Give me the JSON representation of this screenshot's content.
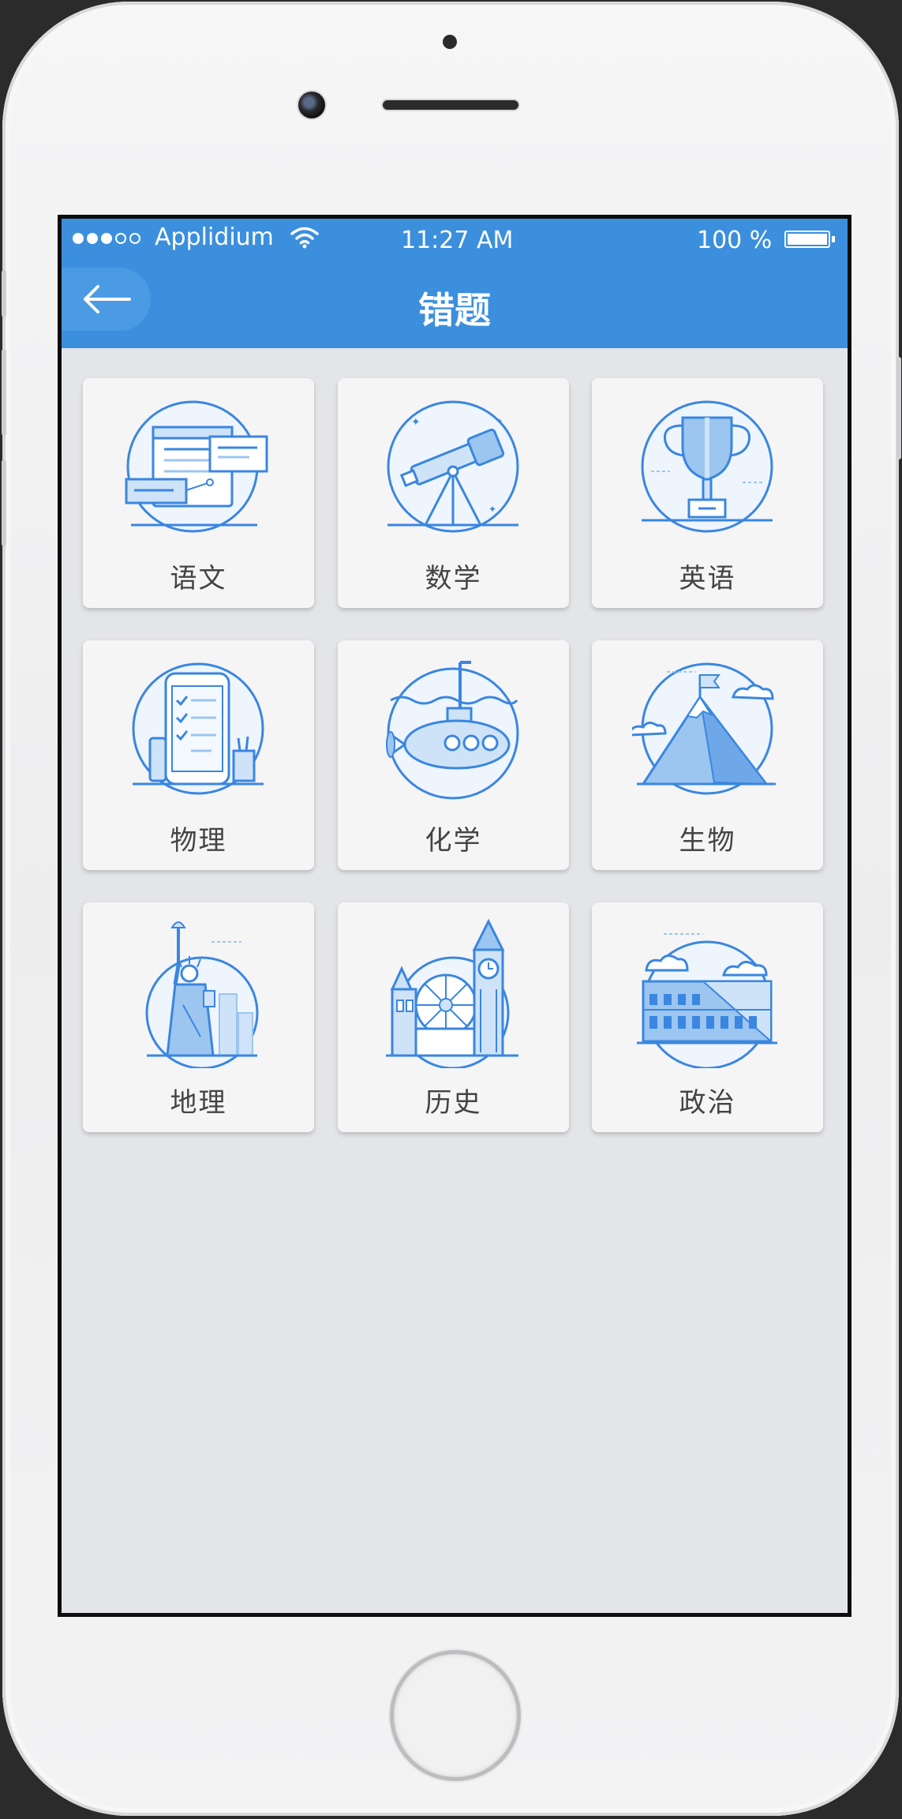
{
  "status_bar": {
    "carrier": "Applidium",
    "time": "11:27 AM",
    "battery": "100 %"
  },
  "nav": {
    "title": "错题",
    "back_icon": "arrow-left-icon"
  },
  "subjects": [
    {
      "label": "语文",
      "icon": "documents-icon"
    },
    {
      "label": "数学",
      "icon": "telescope-icon"
    },
    {
      "label": "英语",
      "icon": "trophy-icon"
    },
    {
      "label": "物理",
      "icon": "phone-checklist-icon"
    },
    {
      "label": "化学",
      "icon": "submarine-icon"
    },
    {
      "label": "生物",
      "icon": "mountain-icon"
    },
    {
      "label": "地理",
      "icon": "statue-of-liberty-icon"
    },
    {
      "label": "历史",
      "icon": "big-ben-icon"
    },
    {
      "label": "政治",
      "icon": "colosseum-icon"
    }
  ],
  "colors": {
    "accent": "#3b8fdd",
    "icon_stroke": "#3a86e0",
    "icon_fill": "#cfe3f8"
  }
}
